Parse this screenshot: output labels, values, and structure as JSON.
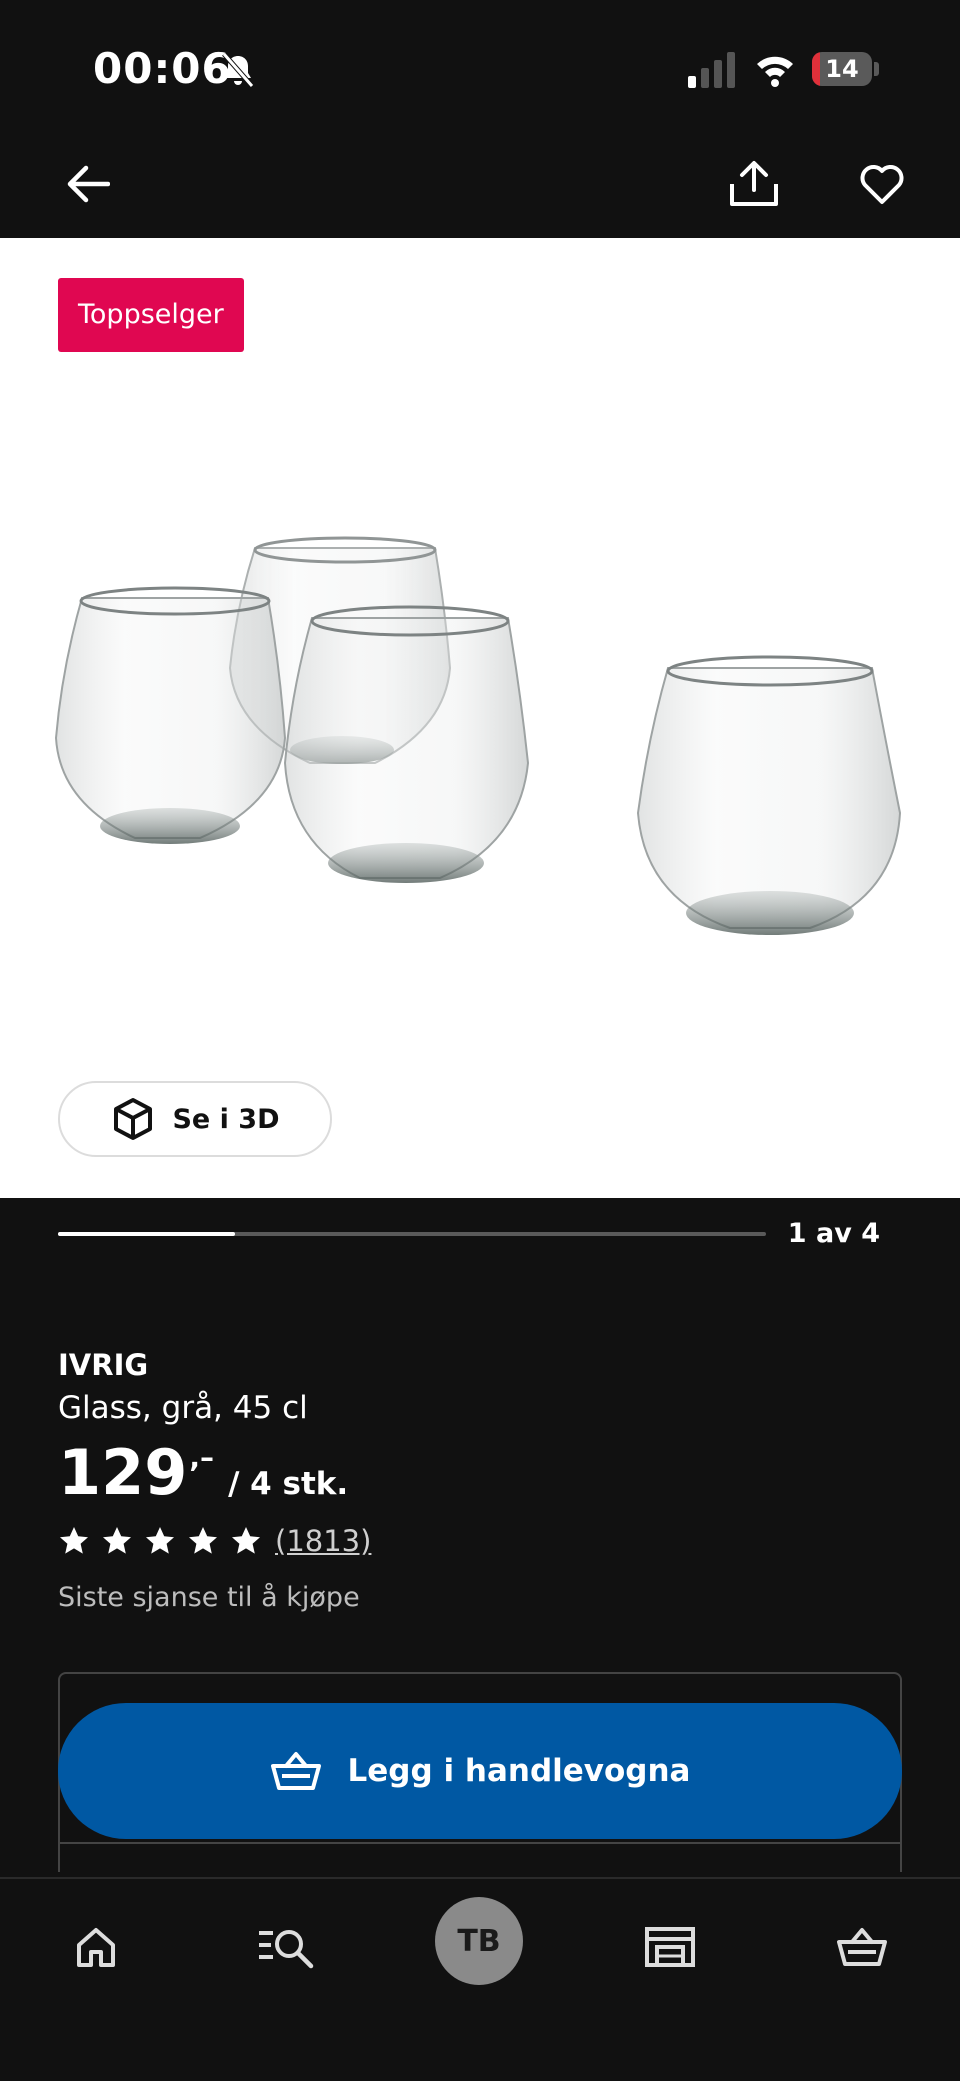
{
  "status_bar": {
    "time": "00:06",
    "battery_level": "14",
    "battery_fraction": 0.14,
    "icons": [
      "bell-slash-icon",
      "signal-icon",
      "wifi-icon",
      "battery-icon"
    ]
  },
  "nav": {
    "icons": [
      "back-arrow-icon",
      "share-icon",
      "heart-icon"
    ]
  },
  "hero": {
    "badge": "Toppselger",
    "view3d_label": "Se i 3D"
  },
  "gallery": {
    "pager": "1 av 4",
    "progress_fraction": 0.25
  },
  "product": {
    "name": "IVRIG",
    "description": "Glass, grå, 45 cl",
    "price": "129",
    "price_suffix": ",–",
    "unit": "/ 4 stk.",
    "stars": 5,
    "rating_count": "(1813)",
    "availability_note": "Siste sjanse til å kjøpe"
  },
  "cart": {
    "button_label": "Legg i handlevogna"
  },
  "tabbar": {
    "avatar_initials": "TB",
    "icons": [
      "home-icon",
      "search-icon",
      "stores-icon",
      "basket-icon"
    ]
  },
  "colors": {
    "badge": "#e00751",
    "primary": "#0058a3",
    "background": "#111111"
  }
}
